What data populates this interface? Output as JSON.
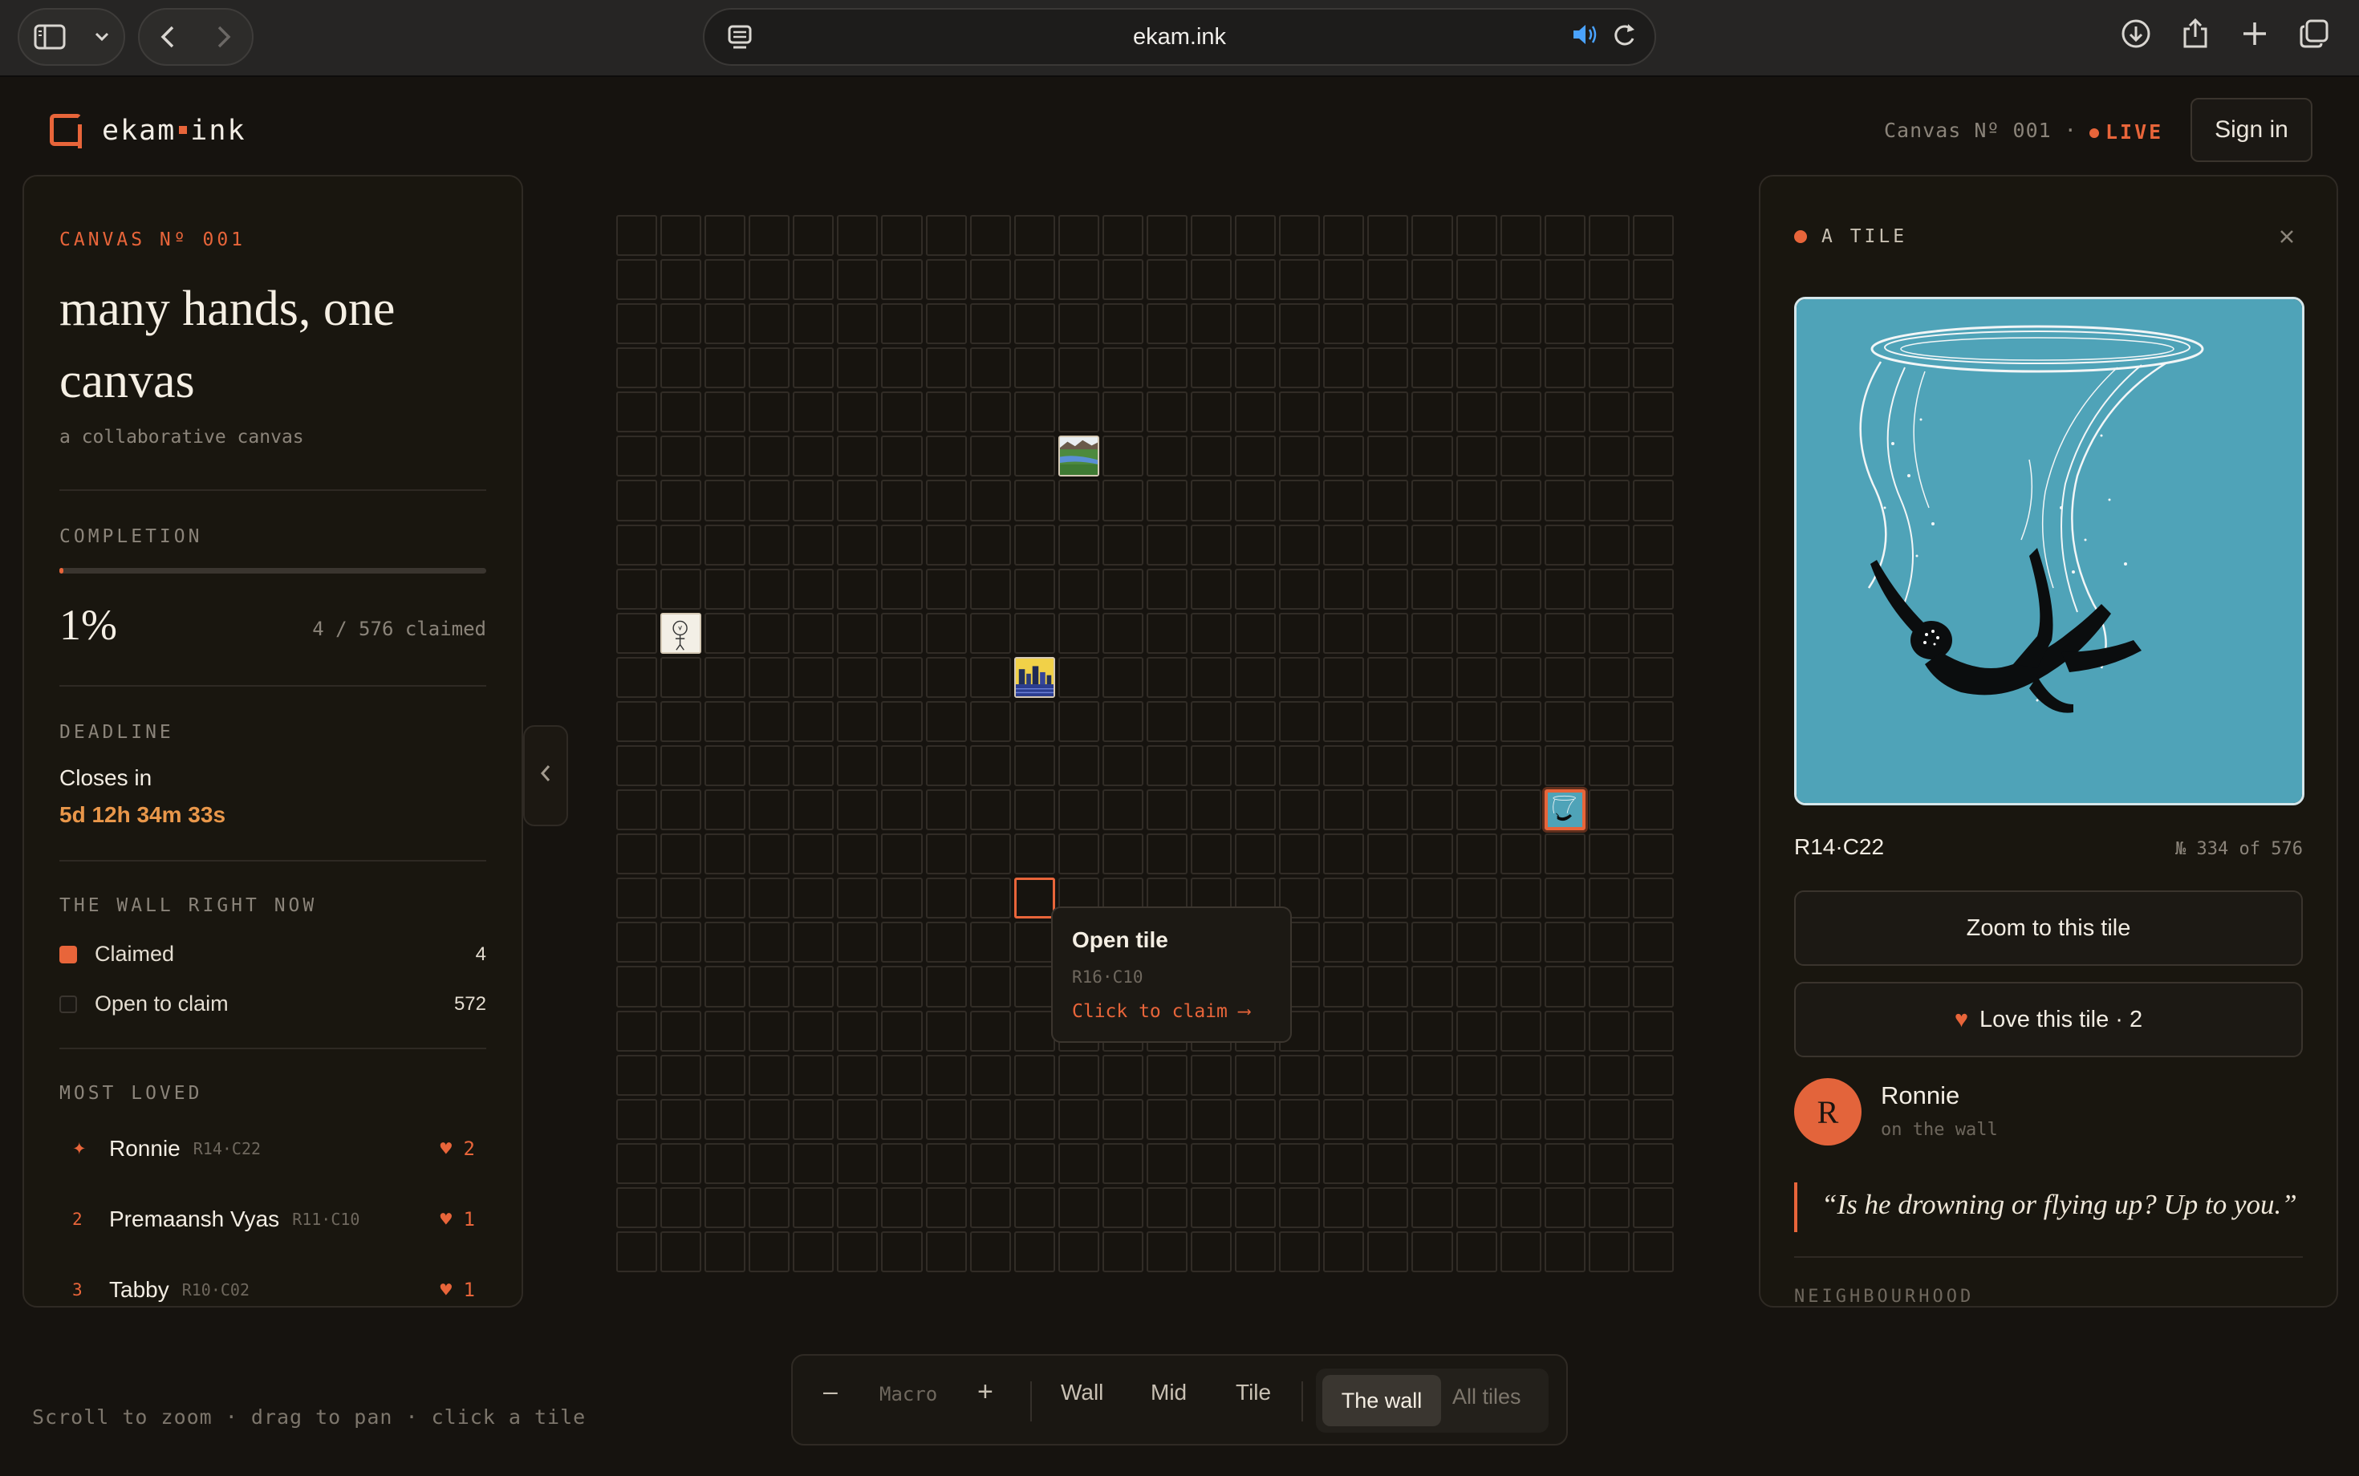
{
  "browser": {
    "url": "ekam.ink"
  },
  "header": {
    "logo_left": "ekam",
    "logo_right": "ink",
    "canvas_label": "Canvas Nº 001 ·",
    "live_label": "LIVE",
    "signin_label": "Sign in"
  },
  "left_panel": {
    "canvas_eyebrow": "CANVAS Nº 001",
    "title": "many hands, one canvas",
    "subtitle": "a collaborative canvas",
    "completion_label": "COMPLETION",
    "completion_fraction": 0.01,
    "completion_pct": "1%",
    "claimed_text": "4 / 576 claimed",
    "deadline_label": "DEADLINE",
    "closes_in_label": "Closes in",
    "countdown": "5d 12h 34m 33s",
    "wall_label": "THE WALL RIGHT NOW",
    "legend": [
      {
        "label": "Claimed",
        "count": "4",
        "color": "#e8653a"
      },
      {
        "label": "Open to claim",
        "count": "572",
        "color": "#2a2620"
      }
    ],
    "most_loved_label": "MOST LOVED",
    "most_loved": [
      {
        "rank": "✦",
        "name": "Ronnie",
        "coord": "R14·C22",
        "loves": "2"
      },
      {
        "rank": "2",
        "name": "Premaansh Vyas",
        "coord": "R11·C10",
        "loves": "1"
      },
      {
        "rank": "3",
        "name": "Tabby",
        "coord": "R10·C02",
        "loves": "1"
      }
    ]
  },
  "grid": {
    "rows": 24,
    "cols": 24,
    "claimed_tiles": [
      {
        "row": 6,
        "col": 11,
        "art": "landscape"
      },
      {
        "row": 10,
        "col": 2,
        "art": "sketch"
      },
      {
        "row": 11,
        "col": 10,
        "art": "city"
      },
      {
        "row": 14,
        "col": 22,
        "art": "diver"
      }
    ],
    "hover_tile": {
      "row": 16,
      "col": 10
    },
    "selected_tile": {
      "row": 14,
      "col": 22
    }
  },
  "tooltip": {
    "title": "Open tile",
    "coord": "R16·C10",
    "cta": "Click to claim ⟶"
  },
  "right_panel": {
    "heading": "A TILE",
    "tile_id": "R14·C22",
    "tile_of": "№ 334 of 576",
    "zoom_label": "Zoom to this tile",
    "love_label": "Love this tile · 2",
    "author_initial": "R",
    "author_name": "Ronnie",
    "author_sub": "on the wall",
    "quote": "“Is he drowning or flying up? Up to you.”",
    "neighbourhood_label": "NEIGHBOURHOOD"
  },
  "footer": {
    "hint": "Scroll to zoom · drag to pan · click a tile",
    "zoom_minus": "–",
    "zoom_level": "Macro",
    "zoom_plus": "+",
    "views": [
      "Wall",
      "Mid",
      "Tile"
    ],
    "mode_active": "The wall",
    "mode_inactive": "All tiles"
  },
  "colors": {
    "accent": "#e8653a",
    "background": "#16130f",
    "tile_art_bg": "#4fa3b8"
  }
}
